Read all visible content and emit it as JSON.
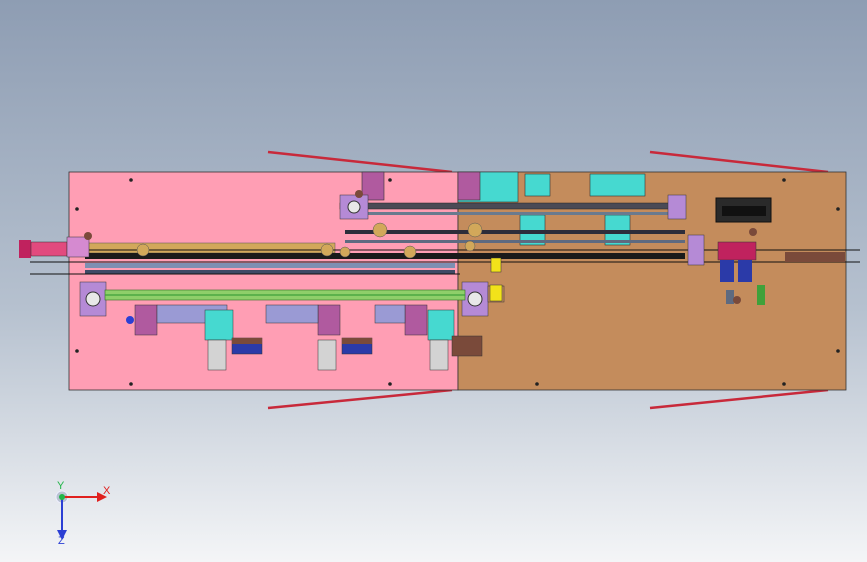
{
  "viewport": {
    "view": "top",
    "colors": {
      "background_top": "#8e9db3",
      "background_bottom": "#f4f5f7",
      "plate_left": "#ff9eb4",
      "plate_right": "#c48c5c",
      "rail": "#8ecf6a",
      "drive_rod": "#3fa13a",
      "motor": "#b05a9f",
      "cylinder": "#46d9d0",
      "guide_wire": "#c8293a",
      "bracket": "#b58ad6"
    },
    "triad": {
      "x_label": "X",
      "y_label": "Y",
      "z_label": "Z",
      "x_color": "#e0201e",
      "y_color": "#23b54a",
      "z_color": "#2b3fd4"
    }
  }
}
